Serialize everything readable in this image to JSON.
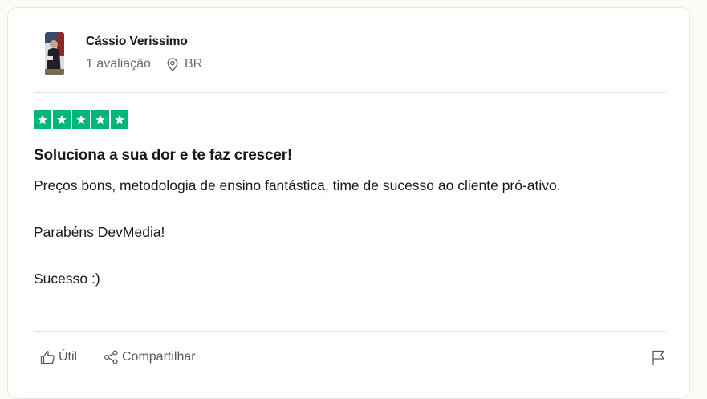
{
  "reviewer": {
    "name": "Cássio Verissimo",
    "reviews_count": "1 avaliação",
    "country": "BR"
  },
  "rating": {
    "stars": 5,
    "max": 5,
    "color": "#00b67a"
  },
  "review": {
    "title": "Soluciona a sua dor e te faz crescer!",
    "paragraphs": [
      "Preços bons, metodologia de ensino fantástica, time de sucesso ao cliente pró-ativo.",
      "Parabéns DevMedia!",
      "Sucesso :)"
    ]
  },
  "actions": {
    "useful_label": "Útil",
    "share_label": "Compartilhar"
  },
  "icons": [
    "avatar",
    "location-pin-icon",
    "star-icon",
    "thumbs-up-icon",
    "share-icon",
    "flag-icon"
  ]
}
